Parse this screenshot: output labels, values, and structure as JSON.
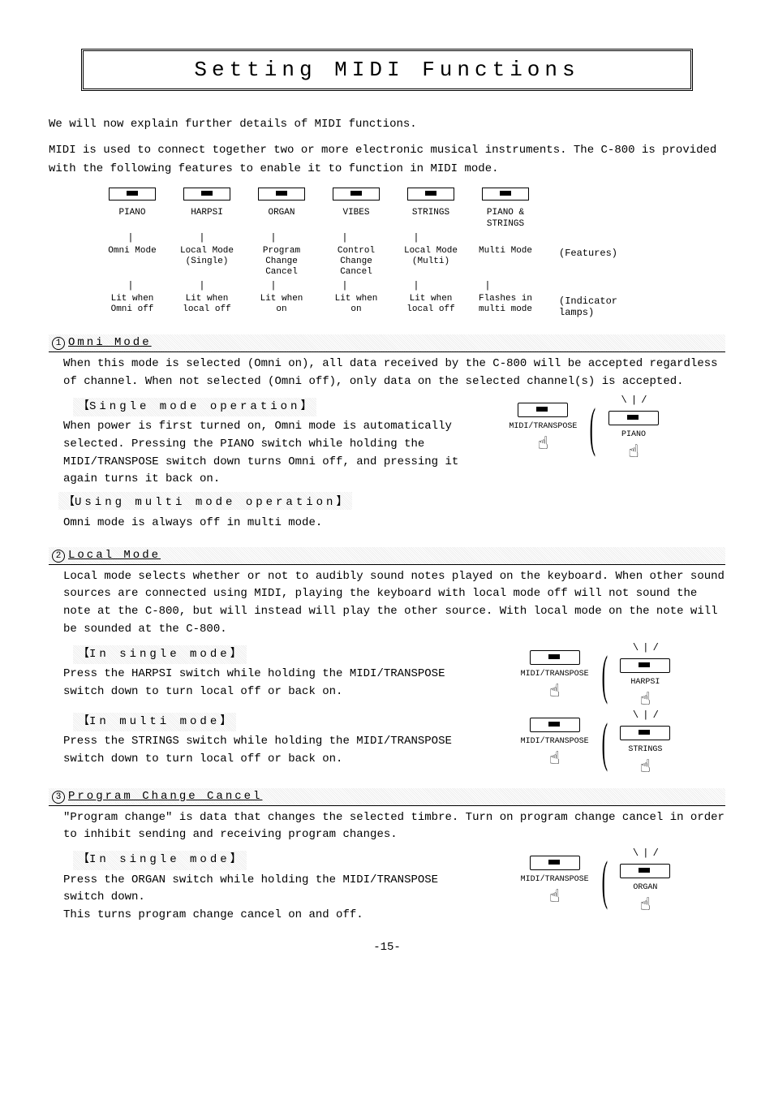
{
  "title": "Setting MIDI Functions",
  "intro_p1": "We will now explain further details of MIDI functions.",
  "intro_p2": "MIDI is used to connect together two or more electronic musical instruments. The C-800 is provided with the following features to enable it to function in MIDI mode.",
  "table": {
    "cols": [
      "PIANO",
      "HARPSI",
      "ORGAN",
      "VIBES",
      "STRINGS",
      "PIANO &\nSTRINGS"
    ],
    "features": [
      "Omni Mode",
      "Local Mode\n(Single)",
      "Program\nChange\nCancel",
      "Control\nChange\nCancel",
      "Local Mode\n(Multi)",
      "Multi Mode"
    ],
    "indicators": [
      "Lit when\nOmni off",
      "Lit when\nlocal off",
      "Lit when\non",
      "Lit when\non",
      "Lit when\nlocal off",
      "Flashes in\nmulti mode"
    ],
    "side_features": "(Features)",
    "side_indicator": "(Indicator\n lamps)"
  },
  "s1": {
    "num": "1",
    "head": "Omni Mode",
    "body": "When this mode is selected (Omni on), all data received by the C-800 will be accepted regardless of channel. When not selected (Omni off), only data on the selected channel(s) is accepted.",
    "sub1": "Single mode operation",
    "sub1_body": "When power is first turned on, Omni mode is automatically selected. Pressing the PIANO switch while holding the MIDI/TRANSPOSE switch down turns Omni off, and pressing it again turns it back on.",
    "sw1": "MIDI/TRANSPOSE",
    "sw2": "PIANO",
    "sub2": "Using multi mode operation",
    "sub2_body": "Omni mode is always off in multi mode."
  },
  "s2": {
    "num": "2",
    "head": "Local Mode",
    "body": "Local mode selects whether or not to audibly sound notes played on the keyboard. When other sound sources are connected using MIDI, playing the keyboard with local mode off will not sound the note at the C-800, but will instead will play the other source. With local mode on the note will be sounded at the C-800.",
    "sub1": "In single mode",
    "sub1_body": "Press the HARPSI switch while holding the MIDI/TRANSPOSE switch down to turn local off or back on.",
    "sw1": "MIDI/TRANSPOSE",
    "sw2": "HARPSI",
    "sub2": "In multi mode",
    "sub2_body": "Press the STRINGS switch while holding the MIDI/TRANSPOSE switch down to turn local off or back on.",
    "sw3": "MIDI/TRANSPOSE",
    "sw4": "STRINGS"
  },
  "s3": {
    "num": "3",
    "head": "Program Change Cancel",
    "body": "\"Program change\" is data that changes the selected timbre. Turn on program change cancel in order to inhibit sending and receiving program changes.",
    "sub1": "In single mode",
    "sub1_body": "Press the ORGAN switch while holding the MIDI/TRANSPOSE switch down.\nThis turns program change cancel on and off.",
    "sw1": "MIDI/TRANSPOSE",
    "sw2": "ORGAN"
  },
  "pagenum": "-15-"
}
